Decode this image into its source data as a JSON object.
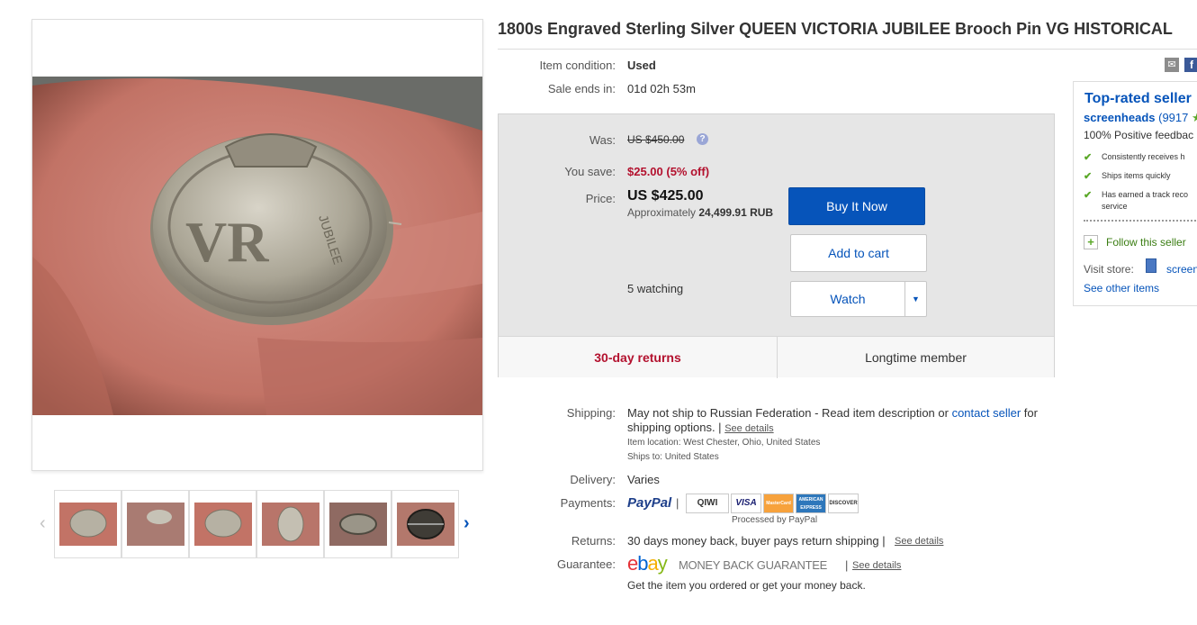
{
  "title": "1800s Engraved Sterling Silver QUEEN VICTORIA JUBILEE Brooch Pin VG HISTORICAL",
  "condition": {
    "label": "Item condition:",
    "value": "Used"
  },
  "sale_ends": {
    "label": "Sale ends in:",
    "value": "01d 02h 53m"
  },
  "price_box": {
    "was_label": "Was:",
    "was_value": "US $450.00",
    "help_icon": "?",
    "save_label": "You save:",
    "save_value": "$25.00 (5% off)",
    "price_label": "Price:",
    "price_value": "US $425.00",
    "approx_prefix": "Approximately",
    "approx_value": "24,499.91 RUB",
    "watching": "5 watching",
    "buy_label": "Buy It Now",
    "cart_label": "Add to cart",
    "watch_label": "Watch",
    "watch_dropdown": "▼",
    "returns_badge": "30-day returns",
    "longtime_badge": "Longtime member"
  },
  "shipping": {
    "label": "Shipping:",
    "text_1": "May not ship to Russian Federation - Read item description or",
    "contact_link": "contact seller",
    "text_2": "for",
    "text_3": "shipping options. |",
    "details_link": "See details",
    "location_label": "Item location:",
    "location_value": "West Chester, Ohio, United States",
    "ships_label": "Ships to:",
    "ships_value": "United States"
  },
  "delivery": {
    "label": "Delivery:",
    "value": "Varies"
  },
  "payments": {
    "label": "Payments:",
    "paypal": "PayPal",
    "sep": "|",
    "logos": [
      "QIWI",
      "VISA",
      "MasterCard",
      "AMERICAN EXPRESS",
      "DISCOVER"
    ],
    "processed": "Processed by PayPal"
  },
  "returns": {
    "label": "Returns:",
    "value": "30 days money back, buyer pays return shipping |",
    "details_link": "See details"
  },
  "guarantee": {
    "label": "Guarantee:",
    "ebay_letters": [
      "e",
      "b",
      "a",
      "y"
    ],
    "mbg": "MONEY BACK GUARANTEE",
    "sep": "|",
    "details_link": "See details",
    "note": "Get the item you ordered or get your money back."
  },
  "seller": {
    "heading": "Top-rated seller",
    "name": "screenheads",
    "score": "(9917",
    "star": "★",
    "feedback": "100% Positive feedbac",
    "perks": [
      "Consistently receives h",
      "Ships items quickly",
      "Has earned a track reco",
      "service"
    ],
    "follow_icon": "+",
    "follow": "Follow this seller",
    "visit_label": "Visit store:",
    "store_name": "screen",
    "other_items": "See other items"
  },
  "thumbnails": {
    "prev_arrow": "‹",
    "next_arrow": "›",
    "count": 6
  },
  "share": {
    "email_icon": "✉",
    "facebook_icon": "f"
  },
  "colors": {
    "brand_blue": "#0654ba",
    "price_red": "#b3112e",
    "check_green": "#5ba829"
  }
}
